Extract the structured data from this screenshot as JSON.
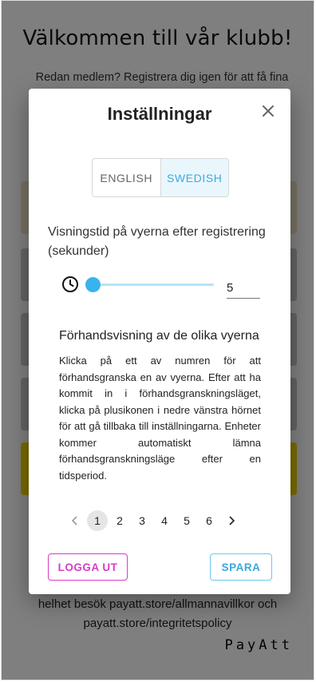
{
  "background": {
    "title": "Välkommen till vår klubb!",
    "subtitle": "Redan medlem? Registrera dig igen för att få fina",
    "footer_line1": "helhet besök payatt.store/allmannavillkor och",
    "footer_line2": "payatt.store/integritetspolicy",
    "brand": "PayAtt"
  },
  "dialog": {
    "title": "Inställningar",
    "close_icon": "close-icon",
    "languages": [
      "ENGLISH",
      "SWEDISH"
    ],
    "selected_language": "SWEDISH",
    "display_time_label": "Visningstid på vyerna efter registrering (sekunder)",
    "clock_icon": "clock-icon",
    "seconds_value": "5",
    "preview_title": "Förhandsvisning av de olika vyerna",
    "preview_text": "Klicka på ett av numren för att förhandsgranska en av vyerna. Efter att ha kommit in i förhandsgranskningsläget, klicka på plusikonen i nedre vänstra hörnet för att gå tillbaka till inställningarna. Enheter kommer automatiskt lämna förhandsgranskningsläge efter en tidsperiod.",
    "pages": [
      "1",
      "2",
      "3",
      "4",
      "5",
      "6"
    ],
    "active_page": "1",
    "prev_icon": "chevron-left-icon",
    "next_icon": "chevron-right-icon",
    "logout_label": "LOGGA UT",
    "save_label": "SPARA"
  },
  "colors": {
    "accent": "#39b3eb",
    "logout": "#d63dc8",
    "overlay": "rgba(0,0,0,0.5)"
  }
}
